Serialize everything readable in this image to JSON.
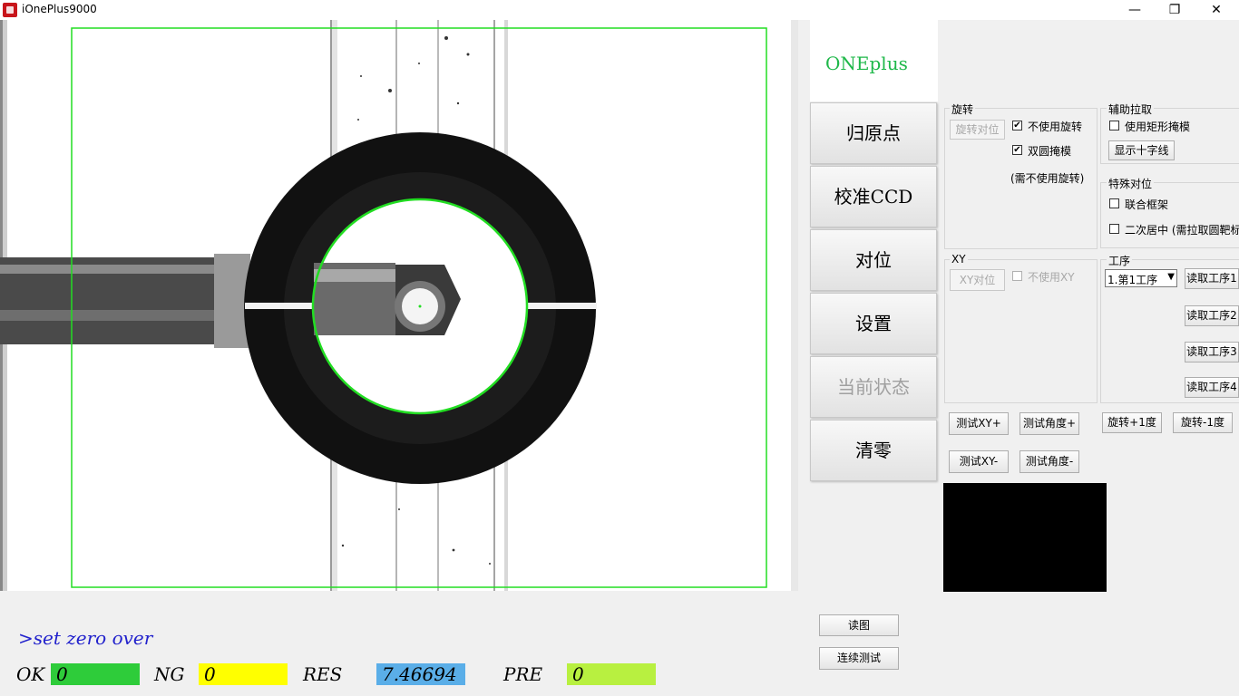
{
  "window": {
    "title": "iOnePlus9000",
    "minimize": "—",
    "maximize": "❐",
    "close": "✕"
  },
  "logo": "ONEplus",
  "side_buttons": [
    "归原点",
    "校准CCD",
    "对位",
    "设置",
    "当前状态",
    "清零"
  ],
  "rotation_group": {
    "label": "旋转",
    "button": "旋转对位",
    "no_rotate_label": "不使用旋转",
    "no_rotate_checked": true,
    "double_circle_label": "双圆掩模",
    "double_circle_checked": true,
    "note": "(需不使用旋转)"
  },
  "aux_group": {
    "label": "辅助拉取",
    "rect_mask_label": "使用矩形掩模",
    "crosshair_button": "显示十字线"
  },
  "special_group": {
    "label": "特殊对位",
    "combo_frame_label": "联合框架",
    "secondary_center_label": "二次居中 (需拉取圆靶标"
  },
  "xy_group": {
    "label": "XY",
    "button": "XY对位",
    "no_xy_label": "不使用XY"
  },
  "process_group": {
    "label": "工序",
    "selected": "1.第1工序",
    "read_buttons": [
      "读取工序1",
      "读取工序2",
      "读取工序3",
      "读取工序4"
    ]
  },
  "test_buttons": {
    "xy_plus": "测试XY+",
    "angle_plus": "测试角度+",
    "xy_minus": "测试XY-",
    "angle_minus": "测试角度-",
    "rotate_plus": "旋转+1度",
    "rotate_minus": "旋转-1度"
  },
  "bottom_buttons": {
    "read_image": "读图",
    "continuous_test": "连续测试"
  },
  "command_line": ">set zero over",
  "stats": {
    "ok_label": "OK",
    "ok_value": "0",
    "ok_color": "#2ecc3a",
    "ng_label": "NG",
    "ng_value": "0",
    "ng_color": "#ffff00",
    "res_label": "RES",
    "res_value": "7.46694",
    "res_color": "#5aaee8",
    "pre_label": "PRE",
    "pre_value": "0",
    "pre_color": "#b8f040"
  },
  "colors": {
    "overlay_green": "#22dd22",
    "logo_green": "#1fb84a"
  }
}
